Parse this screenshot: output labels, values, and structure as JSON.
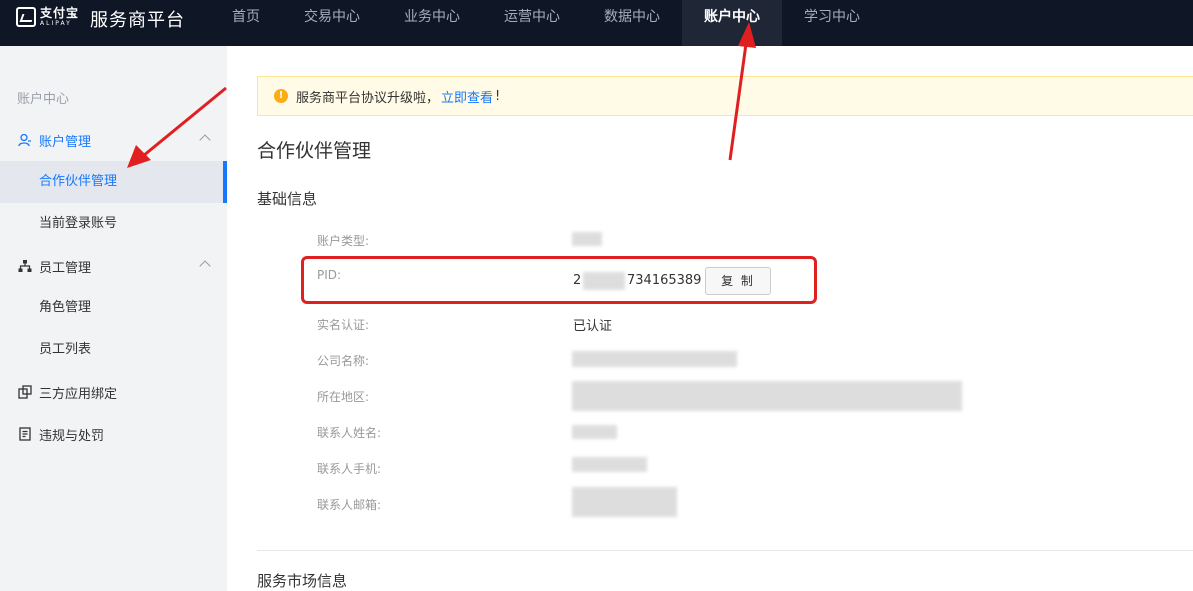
{
  "header": {
    "logo_cn": "支付宝",
    "logo_en": "ALIPAY",
    "brand": "服务商平台",
    "nav": [
      {
        "label": "首页",
        "active": false
      },
      {
        "label": "交易中心",
        "active": false
      },
      {
        "label": "业务中心",
        "active": false
      },
      {
        "label": "运营中心",
        "active": false
      },
      {
        "label": "数据中心",
        "active": false
      },
      {
        "label": "账户中心",
        "active": true
      },
      {
        "label": "学习中心",
        "active": false
      }
    ]
  },
  "sidebar": {
    "title": "账户中心",
    "groups": [
      {
        "label": "账户管理",
        "icon": "user-icon",
        "items": [
          "合作伙伴管理",
          "当前登录账号"
        ]
      },
      {
        "label": "员工管理",
        "icon": "org-chart-icon",
        "items": [
          "角色管理",
          "员工列表"
        ]
      },
      {
        "label": "三方应用绑定",
        "icon": "app-bind-icon",
        "items": []
      },
      {
        "label": "违规与处罚",
        "icon": "document-icon",
        "items": []
      }
    ],
    "active_item": "合作伙伴管理"
  },
  "notice": {
    "text_before": "服务商平台协议升级啦，",
    "link": "立即查看",
    "text_after": "!"
  },
  "main": {
    "title": "合作伙伴管理",
    "section_basic": "基础信息",
    "section_market": "服务市场信息",
    "fields": {
      "account_type_label": "账户类型:",
      "pid_label": "PID:",
      "pid_value_prefix": "2",
      "pid_value_suffix": "734165389",
      "copy_button": "复 制",
      "real_name_label": "实名认证:",
      "real_name_value": "已认证",
      "company_label": "公司名称:",
      "region_label": "所在地区:",
      "contact_name_label": "联系人姓名:",
      "contact_phone_label": "联系人手机:",
      "contact_email_label": "联系人邮箱:"
    }
  },
  "colors": {
    "topbar": "#0f1727",
    "accent": "#1677ff",
    "annotation_red": "#e02020",
    "notice_bg": "#fffbe6"
  }
}
